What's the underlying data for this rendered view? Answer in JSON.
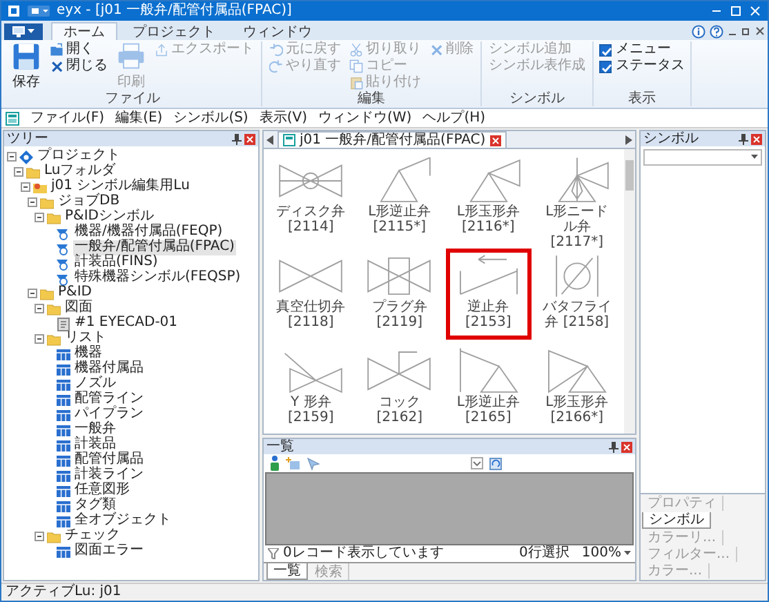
{
  "window": {
    "title": "eyx - [j01 一般弁/配管付属品(FPAC)]"
  },
  "ribbon": {
    "tabs": [
      {
        "label": "ホーム",
        "selected": true
      },
      {
        "label": "プロジェクト",
        "selected": false
      },
      {
        "label": "ウィンドウ",
        "selected": false
      }
    ],
    "groups": [
      {
        "label": "ファイル",
        "columns": [
          [
            {
              "kind": "large_button",
              "label": "保存",
              "disabled": false
            }
          ],
          [
            {
              "kind": "button",
              "label": "開く",
              "disabled": false
            },
            {
              "kind": "button",
              "label": "閉じる",
              "disabled": false
            }
          ],
          [
            {
              "kind": "large_button",
              "label": "印刷",
              "disabled": true
            }
          ],
          [
            {
              "kind": "button",
              "label": "エクスポート",
              "disabled": true
            }
          ]
        ]
      },
      {
        "label": "編集",
        "columns": [
          [
            {
              "kind": "button",
              "label": "元に戻す",
              "disabled": true
            },
            {
              "kind": "button",
              "label": "やり直す",
              "disabled": true
            }
          ],
          [
            {
              "kind": "button",
              "label": "切り取り",
              "disabled": true
            },
            {
              "kind": "button",
              "label": "コピー",
              "disabled": true
            },
            {
              "kind": "button",
              "label": "貼り付け",
              "disabled": true
            }
          ],
          [
            {
              "kind": "button",
              "label": "削除",
              "disabled": true
            }
          ]
        ]
      },
      {
        "label": "シンボル",
        "columns": [
          [
            {
              "kind": "button",
              "label": "シンボル追加",
              "disabled": true
            },
            {
              "kind": "button",
              "label": "シンボル表作成",
              "disabled": true
            }
          ]
        ]
      },
      {
        "label": "表示",
        "columns": [
          [
            {
              "kind": "checkbox",
              "label": "メニュー",
              "checked": true
            },
            {
              "kind": "checkbox",
              "label": "ステータス",
              "checked": true
            }
          ]
        ]
      }
    ]
  },
  "menu": [
    "ファイル(F)",
    "編集(E)",
    "シンボル(S)",
    "表示(V)",
    "ウィンドウ(W)",
    "ヘルプ(H)"
  ],
  "tree_panel": {
    "title": "ツリー",
    "tree": [
      {
        "label": "プロジェクト",
        "kind": "project",
        "selected": false,
        "expanded": true,
        "children": [
          {
            "label": "Luフォルダ",
            "kind": "folder",
            "selected": false,
            "expanded": true,
            "children": [
              {
                "label": "j01 シンボル編集用Lu",
                "kind": "lu",
                "selected": false,
                "expanded": true,
                "children": [
                  {
                    "label": "ジョブDB",
                    "kind": "folder",
                    "selected": false,
                    "expanded": true,
                    "children": [
                      {
                        "label": "P&IDシンボル",
                        "kind": "folder",
                        "selected": false,
                        "expanded": true,
                        "children": [
                          {
                            "label": "機器/機器付属品(FEQP)",
                            "kind": "symbol_db",
                            "selected": false
                          },
                          {
                            "label": "一般弁/配管付属品(FPAC)",
                            "kind": "symbol_db",
                            "selected": true
                          },
                          {
                            "label": "計装品(FINS)",
                            "kind": "symbol_db",
                            "selected": false
                          },
                          {
                            "label": "特殊機器シンボル(FEQSP)",
                            "kind": "symbol_db",
                            "selected": false
                          }
                        ]
                      }
                    ]
                  },
                  {
                    "label": "P&ID",
                    "kind": "folder",
                    "selected": false,
                    "expanded": true,
                    "children": [
                      {
                        "label": "図面",
                        "kind": "folder",
                        "selected": false,
                        "expanded": true,
                        "children": [
                          {
                            "label": "#1 EYECAD-01",
                            "kind": "drawing",
                            "selected": false
                          }
                        ]
                      },
                      {
                        "label": "リスト",
                        "kind": "folder",
                        "selected": false,
                        "expanded": true,
                        "children": [
                          {
                            "label": "機器",
                            "kind": "list",
                            "selected": false
                          },
                          {
                            "label": "機器付属品",
                            "kind": "list",
                            "selected": false
                          },
                          {
                            "label": "ノズル",
                            "kind": "list",
                            "selected": false
                          },
                          {
                            "label": "配管ライン",
                            "kind": "list",
                            "selected": false
                          },
                          {
                            "label": "パイプラン",
                            "kind": "list",
                            "selected": false
                          },
                          {
                            "label": "一般弁",
                            "kind": "list",
                            "selected": false
                          },
                          {
                            "label": "計装品",
                            "kind": "list",
                            "selected": false
                          },
                          {
                            "label": "配管付属品",
                            "kind": "list",
                            "selected": false
                          },
                          {
                            "label": "計装ライン",
                            "kind": "list",
                            "selected": false
                          },
                          {
                            "label": "任意図形",
                            "kind": "list",
                            "selected": false
                          },
                          {
                            "label": "タグ類",
                            "kind": "list",
                            "selected": false
                          },
                          {
                            "label": "全オブジェクト",
                            "kind": "list",
                            "selected": false
                          }
                        ]
                      },
                      {
                        "label": "チェック",
                        "kind": "folder",
                        "selected": false,
                        "expanded": true,
                        "children": [
                          {
                            "label": "図面エラー",
                            "kind": "list",
                            "selected": false
                          }
                        ]
                      }
                    ]
                  }
                ]
              }
            ]
          }
        ]
      }
    ]
  },
  "document_tab": {
    "label": "j01 一般弁/配管付属品(FPAC)"
  },
  "symbols": [
    {
      "label": "ディスク弁 [2114]",
      "selected": false
    },
    {
      "label": "L形逆止弁 [2115*]",
      "selected": false
    },
    {
      "label": "L形玉形弁 [2116*]",
      "selected": false
    },
    {
      "label": "L形ニードル弁 [2117*]",
      "selected": false
    },
    {
      "label": "真空仕切弁 [2118]",
      "selected": false
    },
    {
      "label": "プラグ弁 [2119]",
      "selected": false
    },
    {
      "label": "逆止弁 [2153]",
      "selected": true
    },
    {
      "label": "バタフライ弁 [2158]",
      "selected": false
    },
    {
      "label": "Y 形弁 [2159]",
      "selected": false
    },
    {
      "label": "コック [2162]",
      "selected": false
    },
    {
      "label": "L形逆止弁 [2165]",
      "selected": false
    },
    {
      "label": "L形玉形弁 [2166*]",
      "selected": false
    }
  ],
  "list_panel": {
    "title": "一覧",
    "record_status": "0レコード表示しています",
    "selection": "0行選択",
    "zoom": "100%",
    "tabs": [
      {
        "label": "一覧",
        "selected": true
      },
      {
        "label": "検索",
        "selected": false
      }
    ]
  },
  "symbol_panel": {
    "title": "シンボル",
    "tabs": [
      {
        "label": "プロパティ",
        "selected": false
      },
      {
        "label": "シンボル",
        "selected": true
      },
      {
        "label": "カラーリ...",
        "selected": false
      },
      {
        "label": "フィルター...",
        "selected": false
      },
      {
        "label": "カラー...",
        "selected": false
      }
    ]
  },
  "status_bar": {
    "text": "アクティブLu: j01"
  }
}
